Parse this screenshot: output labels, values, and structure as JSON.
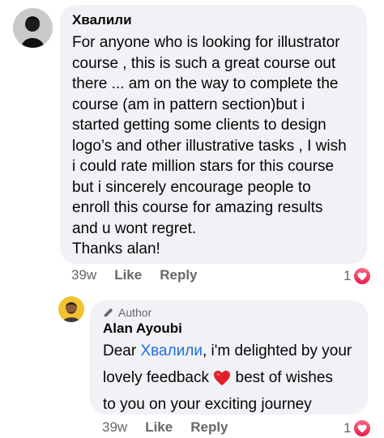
{
  "comment": {
    "author": "Хвалили",
    "lines": [
      "For anyone who is looking for illustrator",
      "course , this is such a great course out",
      "there ... am on the way to complete the",
      "course (am in pattern section)but i",
      "started getting some clients to design",
      "logo’s and other illustrative tasks , I wish",
      "i could rate million stars for this course",
      "but i sincerely encourage people to",
      "enroll this course for amazing results",
      "and u wont regret.",
      "Thanks alan!"
    ],
    "time": "39w",
    "like_label": "Like",
    "reply_label": "Reply",
    "reaction_count": "1",
    "reaction_icon": "heart-icon"
  },
  "reply": {
    "badge_label": "Author",
    "badge_icon": "pencil-icon",
    "author": "Alan Ayoubi",
    "text_prefix": "Dear ",
    "mention": "Хвалили",
    "text_after_mention": ", i'm delighted by your",
    "line2_before_emoji": "lovely feedback ",
    "emoji": "red-heart-emoji",
    "line2_after_emoji": " best of wishes",
    "line3": "to you on your exciting journey",
    "time": "39w",
    "like_label": "Like",
    "reply_label": "Reply",
    "reaction_count": "1",
    "reaction_icon": "heart-icon"
  },
  "colors": {
    "bubble": "#f0f2f5",
    "mention": "#216fdb",
    "meta": "#65676b",
    "heart": "#e61e4d"
  }
}
